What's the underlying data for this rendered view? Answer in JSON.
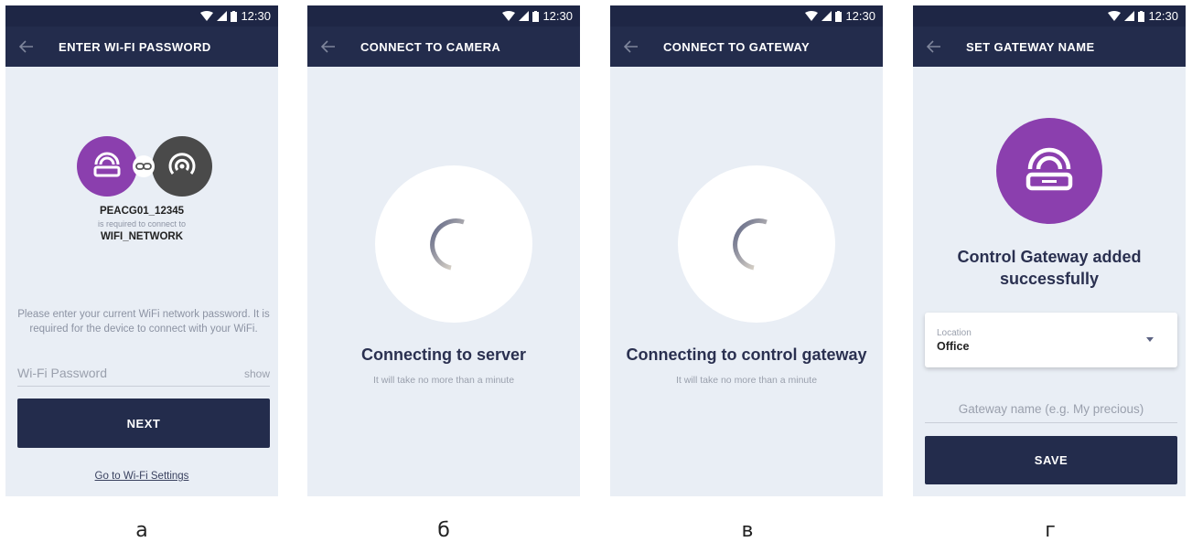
{
  "status": {
    "time": "12:30"
  },
  "screens": {
    "a": {
      "title": "ENTER WI-FI PASSWORD",
      "device_name": "PEACG01_12345",
      "required_text": "is required to connect to",
      "network_name": "WIFI_NETWORK",
      "instructions": "Please enter your current WiFi network password. It is required for the device to connect with your WiFi.",
      "password_placeholder": "Wi-Fi Password",
      "show_label": "show",
      "next_label": "NEXT",
      "settings_link": "Go to Wi-Fi Settings",
      "caption": "а"
    },
    "b": {
      "title": "CONNECT TO CAMERA",
      "heading": "Connecting to server",
      "subtext": "It will take no more than a minute",
      "caption": "б"
    },
    "c": {
      "title": "CONNECT TO GATEWAY",
      "heading": "Connecting to control gateway",
      "subtext": "It will take no more than a minute",
      "caption": "в"
    },
    "d": {
      "title": "SET GATEWAY NAME",
      "success_message": "Control Gateway added successfully",
      "location_label": "Location",
      "location_value": "Office",
      "name_placeholder": "Gateway name (e.g. My precious)",
      "save_label": "SAVE",
      "caption": "г"
    }
  },
  "colors": {
    "header": "#232c4c",
    "status_bar": "#1e2645",
    "background": "#e9eef5",
    "accent_purple": "#8b3fae",
    "device_gray": "#4a4a4a"
  },
  "icons": [
    "back-arrow-icon",
    "wifi-signal-icon",
    "cell-signal-icon",
    "battery-icon",
    "gateway-icon",
    "camera-icon",
    "link-icon",
    "spinner-icon",
    "dropdown-arrow-icon"
  ]
}
